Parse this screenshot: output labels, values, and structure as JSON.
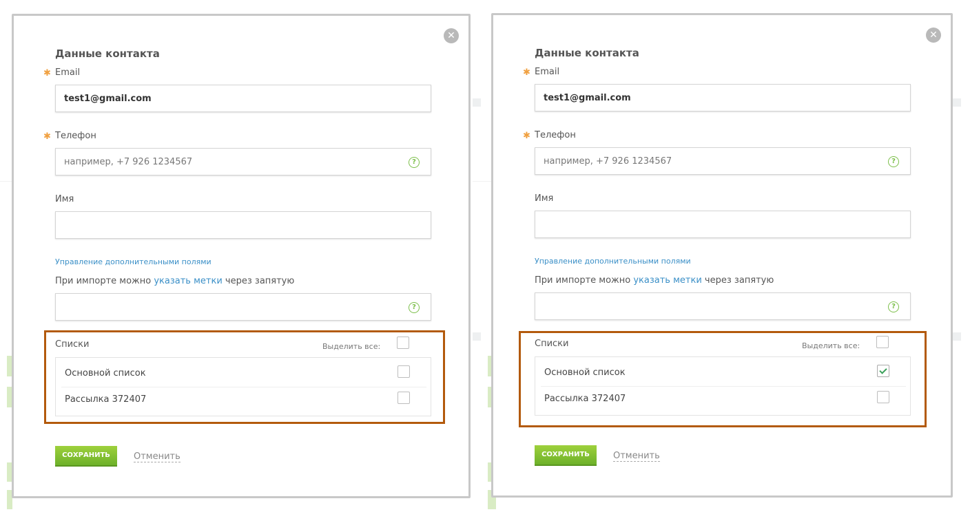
{
  "modals": [
    {
      "title": "Данные контакта",
      "email": {
        "label": "Email",
        "value": "test1@gmail.com"
      },
      "phone": {
        "label": "Телефон",
        "placeholder": "например, +7 926 1234567"
      },
      "name": {
        "label": "Имя",
        "value": ""
      },
      "manage_fields_link": "Управление дополнительными полями",
      "tags": {
        "prefix": "При импорте можно ",
        "link1": "указать",
        "link2": "метки",
        "suffix": " через запятую"
      },
      "lists": {
        "title": "Списки",
        "select_all": "Выделить все:",
        "select_all_checked": false,
        "items": [
          {
            "name": "Основной список",
            "checked": false
          },
          {
            "name": "Рассылка 372407",
            "checked": false
          }
        ]
      },
      "save_label": "СОХРАНИТЬ",
      "cancel_label": "Отменить"
    },
    {
      "title": "Данные контакта",
      "email": {
        "label": "Email",
        "value": "test1@gmail.com"
      },
      "phone": {
        "label": "Телефон",
        "placeholder": "например, +7 926 1234567"
      },
      "name": {
        "label": "Имя",
        "value": ""
      },
      "manage_fields_link": "Управление дополнительными полями",
      "tags": {
        "prefix": "При импорте можно ",
        "link1": "указать",
        "link2": "метки",
        "suffix": " через запятую"
      },
      "lists": {
        "title": "Списки",
        "select_all": "Выделить все:",
        "select_all_checked": false,
        "items": [
          {
            "name": "Основной список",
            "checked": true
          },
          {
            "name": "Рассылка 372407",
            "checked": false
          }
        ]
      },
      "save_label": "СОХРАНИТЬ",
      "cancel_label": "Отменить"
    }
  ],
  "icons": {
    "close": "close-icon",
    "help": "help-icon",
    "required": "asterisk-icon",
    "check": "checkmark-icon"
  },
  "colors": {
    "accent_green": "#7cbf4a",
    "link_blue": "#3a8fc7",
    "highlight_border": "#b35a0c",
    "required_orange": "#f0a040"
  }
}
